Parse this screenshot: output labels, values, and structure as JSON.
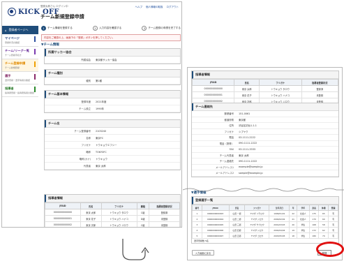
{
  "header": {
    "logo": "KICK OFF",
    "breadcrumb": "登録太郎さん ログイン中",
    "links": [
      "ヘルプ",
      "個人情報の取扱",
      "ログアウト"
    ],
    "page_title": "チーム新規登録申請"
  },
  "sidebar": {
    "head": "登録者ページへ",
    "items": [
      {
        "label": "マイページ",
        "sub": "登録状況の確認"
      },
      {
        "label": "チーム/リーグ一覧",
        "sub": "チーム登録手続き"
      },
      {
        "label": "チーム登録申請",
        "sub": "チーム新規登録"
      },
      {
        "label": "選手",
        "sub": "選手登録・選手情報の確認"
      },
      {
        "label": "指導者",
        "sub": "指導者登録・指導者情報の確認"
      }
    ]
  },
  "steps": [
    {
      "num": "1",
      "label": "チーム情報を登録する"
    },
    {
      "num": "2",
      "label": "入力内容を確認する"
    },
    {
      "num": "3",
      "label": "チーム登録の申請を完了する"
    }
  ],
  "notice": "内容をご確認の上、画面下の「登録」ボタンを押してください。",
  "section_title": "チーム情報",
  "p1": {
    "assoc_box": {
      "title": "所属サッカー協会",
      "rows": [
        {
          "k": "所属協会",
          "v": "東京都サッカー協会"
        }
      ]
    },
    "type_box": {
      "title": "チーム種別",
      "rows": [
        {
          "k": "種別",
          "v": "第1種"
        }
      ]
    },
    "basic_box": {
      "title": "チーム基本情報",
      "rows": [
        {
          "k": "登録年度",
          "v": "2021年度"
        },
        {
          "k": "チーム設立",
          "v": "1990年"
        }
      ]
    },
    "name_box": {
      "title": "チーム名",
      "rows": [
        {
          "k": "チーム登録番号",
          "v": "2103240"
        },
        {
          "k": "名称",
          "v": "東京FC"
        },
        {
          "k": "フリガナ",
          "v": "トウキョウエフシー"
        },
        {
          "k": "略称",
          "v": "TOKYOFC"
        },
        {
          "k": "略称(カナ)",
          "v": "トウキョウ"
        },
        {
          "k": "代表者",
          "v": "東京 太郎"
        }
      ]
    },
    "staff_box": {
      "title": "指導者情報",
      "headers": [
        "JFAID",
        "氏名",
        "フリガナ",
        "資格",
        "指導者登録状況"
      ],
      "rows": [
        [
          "0000000000000",
          "東京 太郎",
          "トウキョウ タロウ",
          "C級",
          "登録済"
        ],
        [
          "0000000000001",
          "東京 花子",
          "トウキョウ ハナコ",
          "D級",
          "未登録"
        ],
        [
          "0000000000002",
          "東京 次郎",
          "トウキョウ ジロウ",
          "C級",
          "未登録"
        ]
      ]
    }
  },
  "p2": {
    "staff_box": {
      "title": "指導者情報",
      "headers": [
        "JFAID",
        "氏名",
        "フリガナ",
        "指導者登録状況"
      ],
      "rows": [
        [
          "0000000000000",
          "東京 太郎",
          "トウキョウ タロウ",
          "登録済"
        ],
        [
          "0000000000001",
          "東京 花子",
          "トウキョウ ハナコ",
          "未登録"
        ],
        [
          "0000000000002",
          "東京 次郎",
          "トウキョウ ジロウ",
          "未登録"
        ]
      ]
    },
    "contact_box": {
      "title": "チーム連絡先",
      "rows": [
        {
          "k": "郵便番号",
          "v": "151-0061"
        },
        {
          "k": "都道府県",
          "v": "東京都"
        },
        {
          "k": "住所",
          "v": "渋谷区初台1-1-1"
        },
        {
          "k": "フリガナ",
          "v": "シブヤク"
        },
        {
          "k": "電話",
          "v": "03-1111-2222"
        },
        {
          "k": "電話（携帯）",
          "v": "090-1111-2222"
        },
        {
          "k": "FAX",
          "v": "03-1111-3333"
        },
        {
          "k": "チーム代表者",
          "v": "東京 太郎"
        },
        {
          "k": "チーム連絡先",
          "v": "090-1111-2222"
        },
        {
          "k": "メールアドレス1",
          "v": "example@sample.jp"
        },
        {
          "k": "メールアドレス2",
          "v": "sample@example.jp"
        }
      ]
    },
    "players_title": "選手情報",
    "players_box": {
      "title": "登録選手一覧",
      "headers": [
        "番号",
        "JFAID",
        "氏名",
        "フリガナ",
        "生年月日",
        "年",
        "学年",
        "身長",
        "体重",
        "登録"
      ],
      "rows": [
        [
          "1",
          "0000000000003",
          "山田 一郎",
          "ヤマダ イチロウ",
          "1999/01/01",
          "22",
          "社会人",
          "175",
          "65",
          "有"
        ],
        [
          "2",
          "0000000000004",
          "山田 二郎",
          "ヤマダ ジロウ",
          "2000/02/02",
          "21",
          "社会人",
          "170",
          "60",
          "有"
        ],
        [
          "3",
          "0000000000005",
          "山田 三郎",
          "ヤマダ サブロウ",
          "2001/03/03",
          "20",
          "学生",
          "168",
          "58",
          "有"
        ],
        [
          "4",
          "0000000000006",
          "山田 四郎",
          "ヤマダ シロウ",
          "2002/04/04",
          "19",
          "学生",
          "172",
          "62",
          "有"
        ],
        [
          "5",
          "0000000000007",
          "山田 五郎",
          "ヤマダ ゴロウ",
          "2003/05/05",
          "18",
          "学生",
          "180",
          "70",
          "有"
        ]
      ],
      "count": "選手登録数 5名"
    },
    "back_btn": "入力画面に戻る",
    "submit_btn": "登録"
  },
  "colors": {
    "accent": "#1f4d7a",
    "highlight": "#e01010"
  }
}
